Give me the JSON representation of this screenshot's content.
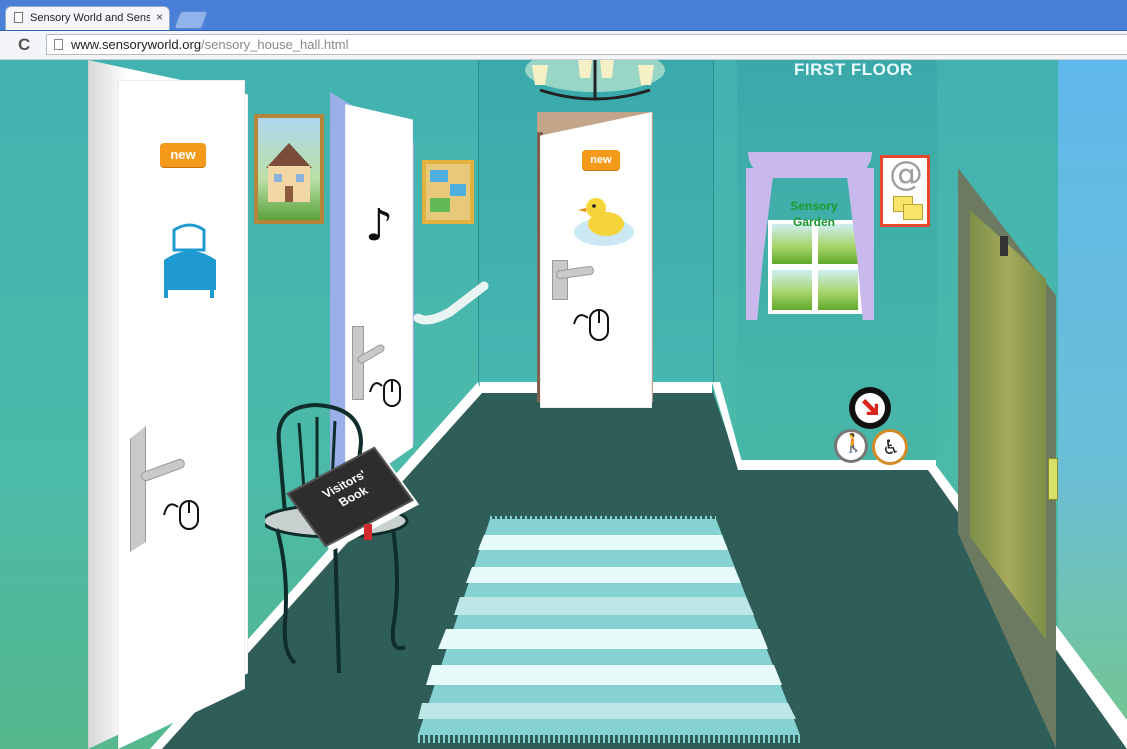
{
  "browser": {
    "tab_title": "Sensory World and Sensory H",
    "tab_close": "×",
    "reload_glyph": "C",
    "url_host": "www.sensoryworld.org",
    "url_path": "/sensory_house_hall.html"
  },
  "scene": {
    "floor_title": "FIRST FLOOR",
    "new_label_left": "new",
    "new_label_center": "new",
    "garden_line1": "Sensory",
    "garden_line2": "Garden",
    "email_glyph": "@",
    "music_glyph": "♪",
    "visitors_book_line1": "Visitors'",
    "visitors_book_line2": "Book",
    "icons": {
      "bed": "bed-icon",
      "duck": "duck-icon",
      "mouse": "mouse-icon",
      "arrow": "red-arrow-icon",
      "walking": "walking-person-icon",
      "wheelchair": "wheelchair-icon"
    },
    "colors": {
      "wall": "#42b2b1",
      "floor": "#2e5b57",
      "new_badge": "#f39a1a",
      "email_border": "#e6482e",
      "garden_text": "#1b9a2b"
    }
  }
}
